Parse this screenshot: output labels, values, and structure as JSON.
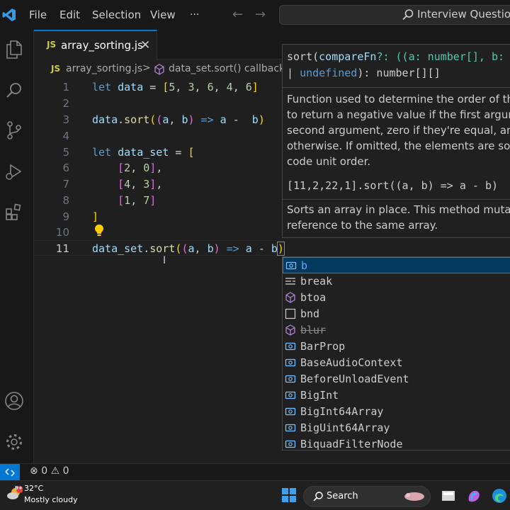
{
  "titlebar": {
    "menu": [
      "File",
      "Edit",
      "Selection",
      "View"
    ],
    "more": "···",
    "command_center": "Interview Questions"
  },
  "tab": {
    "badge": "JS",
    "label": "array_sorting.js"
  },
  "breadcrumb": {
    "badge": "JS",
    "file": "array_sorting.js",
    "separator": ">",
    "symbol": "data_set.sort() callback"
  },
  "editor": {
    "line_numbers": [
      "1",
      "2",
      "3",
      "4",
      "5",
      "6",
      "7",
      "8",
      "9",
      "10",
      "11"
    ],
    "active_line": 11
  },
  "hover": {
    "signature_line1_start": "sort(",
    "param": "compareFn",
    "sig_mid": "?: ((a: number[], b: ",
    "sig_line2_start": "| ",
    "undefined_kw": "undefined",
    "sig_end": "): number[][]",
    "doc_lines": [
      "Function used to determine the order of th",
      "to return a negative value if the first argum",
      "second argument, zero if they're equal, and",
      "otherwise. If omitted, the elements are sort",
      "code unit order."
    ],
    "example": "[11,2,22,1].sort((a, b) => a - b)",
    "doc2_lines": [
      "Sorts an array in place. This method mutate",
      "reference to the same array."
    ]
  },
  "suggestions": [
    {
      "label": "b",
      "icon": "variable-icon",
      "selected": true
    },
    {
      "label": "break",
      "icon": "keyword-icon"
    },
    {
      "label": "btoa",
      "icon": "method-icon"
    },
    {
      "label": "bnd",
      "icon": "snippet-icon"
    },
    {
      "label": "blur",
      "icon": "method-icon",
      "deprecated": true
    },
    {
      "label": "BarProp",
      "icon": "variable-icon"
    },
    {
      "label": "BaseAudioContext",
      "icon": "variable-icon"
    },
    {
      "label": "BeforeUnloadEvent",
      "icon": "variable-icon"
    },
    {
      "label": "BigInt",
      "icon": "variable-icon"
    },
    {
      "label": "BigInt64Array",
      "icon": "variable-icon"
    },
    {
      "label": "BigUint64Array",
      "icon": "variable-icon"
    },
    {
      "label": "BiquadFilterNode",
      "icon": "variable-icon"
    }
  ],
  "statusbar": {
    "errors": "0",
    "warnings": "0"
  },
  "taskbar": {
    "badge": "9+",
    "temp": "32°C",
    "weather": "Mostly cloudy",
    "search": "Search"
  },
  "colors": {
    "accent": "#0078d4",
    "keyword": "#569cd6",
    "variable": "#9cdcfe",
    "function": "#dcdcaa",
    "number": "#b5cea8"
  }
}
